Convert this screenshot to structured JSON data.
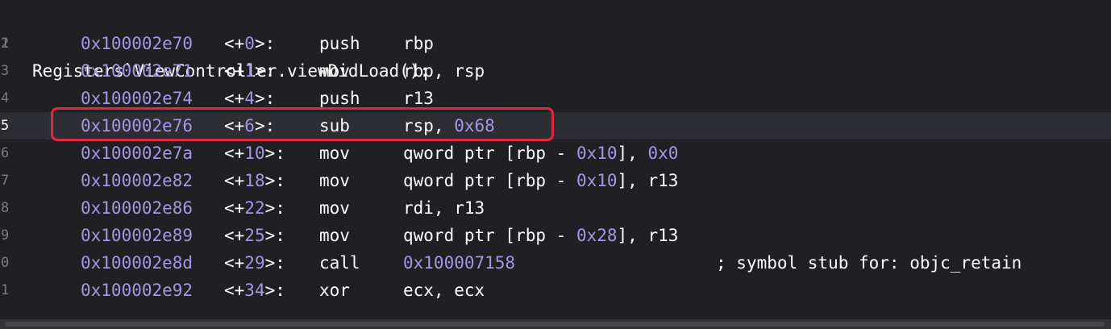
{
  "title_line": {
    "number": "1",
    "text": "Registers`ViewController.viewDidLoad():"
  },
  "current_line": 5,
  "highlight_color": "#e0283c",
  "instructions": [
    {
      "line": "2",
      "address": "0x100002e70",
      "off_open": "<+",
      "offset": "0",
      "off_close": ">:",
      "mnemonic": "push",
      "operands": [
        {
          "t": "rbp"
        }
      ],
      "comment": ""
    },
    {
      "line": "3",
      "address": "0x100002e71",
      "off_open": "<+",
      "offset": "1",
      "off_close": ">:",
      "mnemonic": "mov",
      "operands": [
        {
          "t": "rbp, rsp"
        }
      ],
      "comment": ""
    },
    {
      "line": "4",
      "address": "0x100002e74",
      "off_open": "<+",
      "offset": "4",
      "off_close": ">:",
      "mnemonic": "push",
      "operands": [
        {
          "t": "r13"
        }
      ],
      "comment": ""
    },
    {
      "line": "5",
      "address": "0x100002e76",
      "off_open": "<+",
      "offset": "6",
      "off_close": ">:",
      "mnemonic": "sub",
      "operands": [
        {
          "t": "rsp, "
        },
        {
          "n": "0x68"
        }
      ],
      "comment": ""
    },
    {
      "line": "6",
      "address": "0x100002e7a",
      "off_open": "<+",
      "offset": "10",
      "off_close": ">:",
      "mnemonic": "mov",
      "operands": [
        {
          "t": "qword ptr [rbp - "
        },
        {
          "n": "0x10"
        },
        {
          "t": "], "
        },
        {
          "n": "0x0"
        }
      ],
      "comment": ""
    },
    {
      "line": "7",
      "address": "0x100002e82",
      "off_open": "<+",
      "offset": "18",
      "off_close": ">:",
      "mnemonic": "mov",
      "operands": [
        {
          "t": "qword ptr [rbp - "
        },
        {
          "n": "0x10"
        },
        {
          "t": "], r13"
        }
      ],
      "comment": ""
    },
    {
      "line": "8",
      "address": "0x100002e86",
      "off_open": "<+",
      "offset": "22",
      "off_close": ">:",
      "mnemonic": "mov",
      "operands": [
        {
          "t": "rdi, r13"
        }
      ],
      "comment": ""
    },
    {
      "line": "9",
      "address": "0x100002e89",
      "off_open": "<+",
      "offset": "25",
      "off_close": ">:",
      "mnemonic": "mov",
      "operands": [
        {
          "t": "qword ptr [rbp - "
        },
        {
          "n": "0x28"
        },
        {
          "t": "], r13"
        }
      ],
      "comment": ""
    },
    {
      "line": "0",
      "address": "0x100002e8d",
      "off_open": "<+",
      "offset": "29",
      "off_close": ">:",
      "mnemonic": "call",
      "operands": [
        {
          "n": "0x100007158"
        }
      ],
      "comment": "; symbol stub for: objc_retain"
    },
    {
      "line": "1",
      "address": "0x100002e92",
      "off_open": "<+",
      "offset": "34",
      "off_close": ">:",
      "mnemonic": "xor",
      "operands": [
        {
          "t": "ecx, ecx"
        }
      ],
      "comment": ""
    }
  ]
}
